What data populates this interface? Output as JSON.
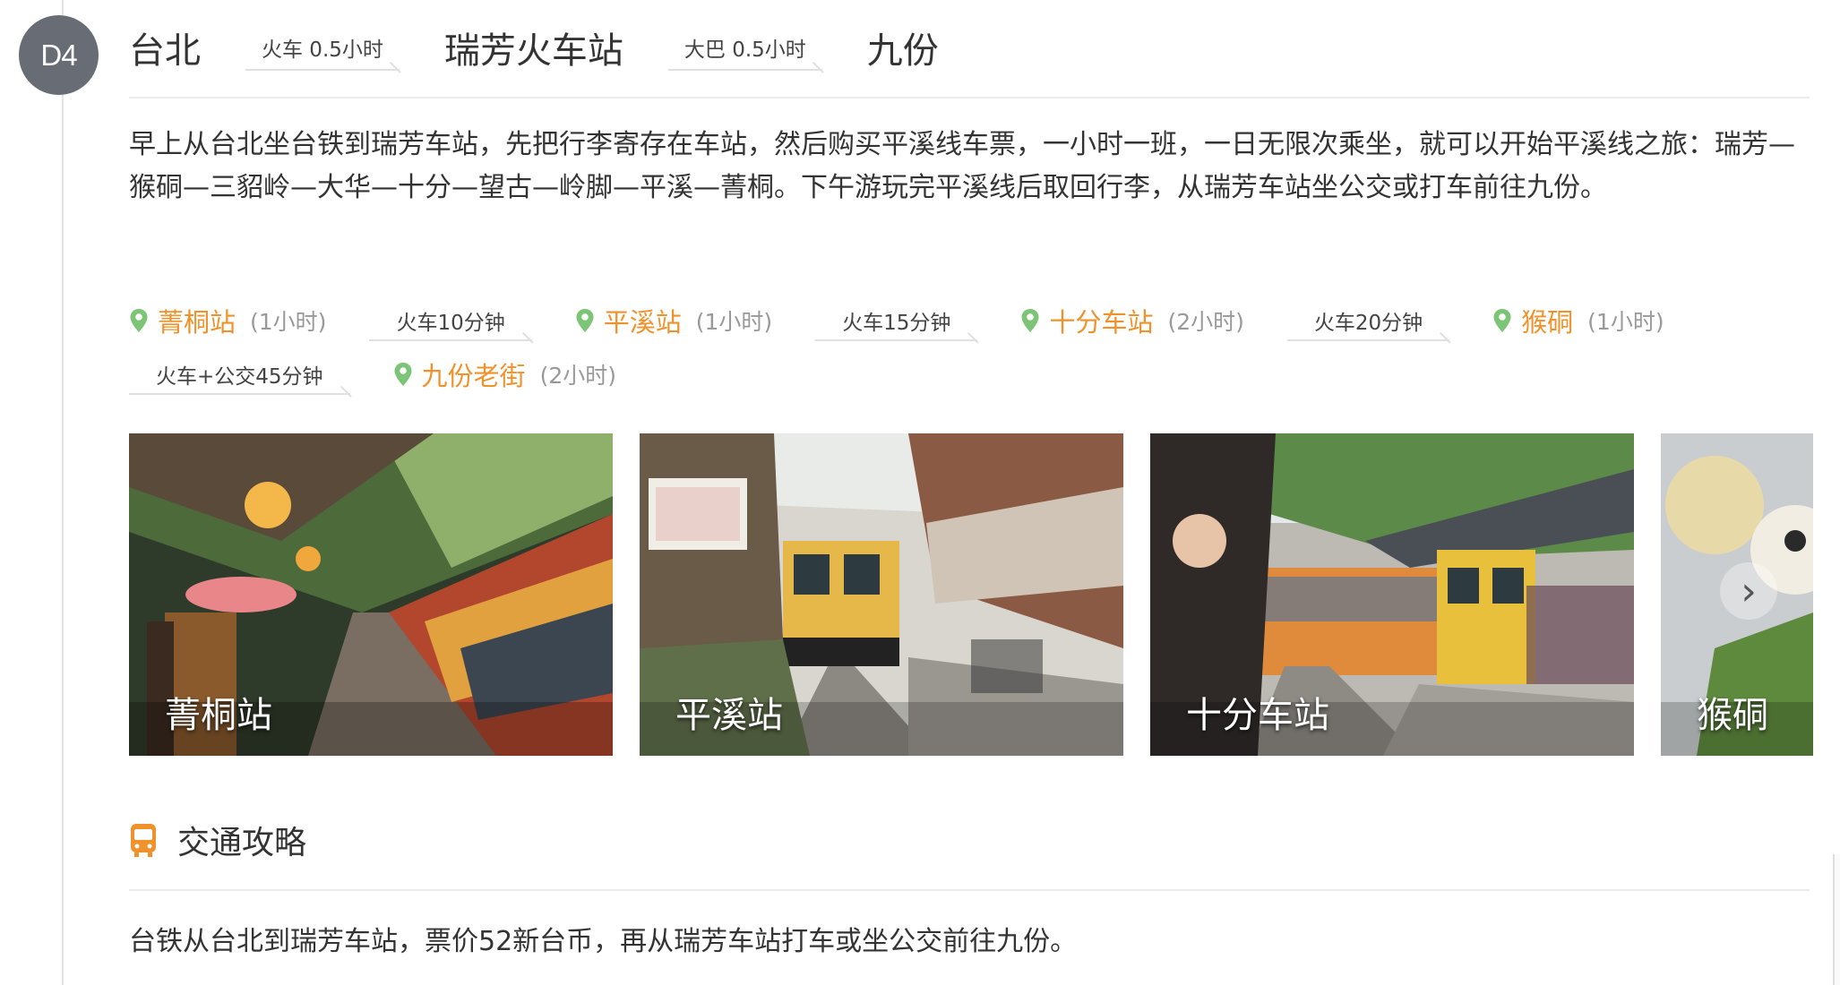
{
  "day": {
    "badge": "D4"
  },
  "route": {
    "stops": [
      "台北",
      "瑞芳火车站",
      "九份"
    ],
    "transits": [
      "火车 0.5小时",
      "大巴 0.5小时"
    ]
  },
  "description": "早上从台北坐台铁到瑞芳车站，先把行李寄存在车站，然后购买平溪线车票，一小时一班，一日无限次乘坐，就可以开始平溪线之旅：瑞芳—猴硐—三貂岭—大华—十分—望古—岭脚—平溪—菁桐。下午游玩完平溪线后取回行李，从瑞芳车站坐公交或打车前往九份。",
  "itinerary": {
    "row1": [
      {
        "name": "菁桐站",
        "duration": "(1小时)"
      },
      {
        "leg": "火车10分钟"
      },
      {
        "name": "平溪站",
        "duration": "(1小时)"
      },
      {
        "leg": "火车15分钟"
      },
      {
        "name": "十分车站",
        "duration": "(2小时)"
      },
      {
        "leg": "火车20分钟"
      },
      {
        "name": "猴硐",
        "duration": "(1小时)"
      }
    ],
    "row2": [
      {
        "leg": "火车+公交45分钟"
      },
      {
        "name": "九份老街",
        "duration": "(2小时)"
      }
    ]
  },
  "gallery": {
    "photos": [
      {
        "caption": "菁桐站"
      },
      {
        "caption": "平溪站"
      },
      {
        "caption": "十分车站"
      },
      {
        "caption": "猴硐"
      }
    ]
  },
  "transport": {
    "title": "交通攻略",
    "text": "台铁从台北到瑞芳车站，票价52新台币，再从瑞芳车站打车或坐公交前往九份。"
  },
  "icons": {
    "pin": "map-pin-icon",
    "bus": "bus-icon",
    "next": "chevron-right-icon"
  },
  "colors": {
    "accent": "#f0922b",
    "pin": "#7cc576",
    "badge": "#676c75"
  }
}
